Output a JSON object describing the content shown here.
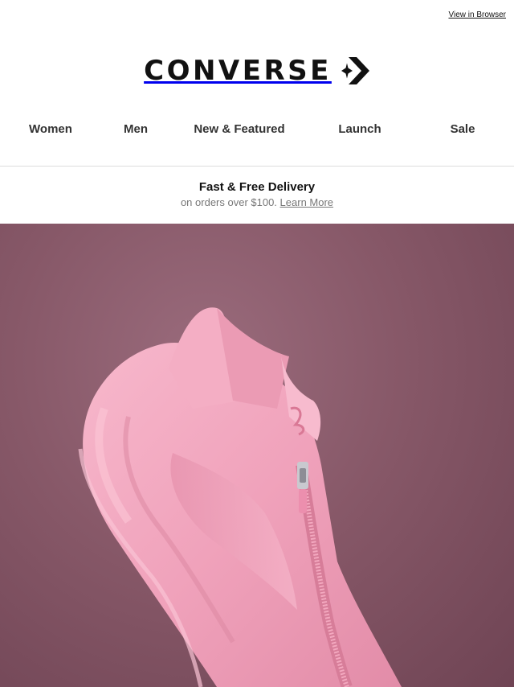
{
  "header": {
    "view_in_browser": "View in Browser",
    "brand": "CONVERSE"
  },
  "nav": {
    "items": [
      {
        "label": "Women"
      },
      {
        "label": "Men"
      },
      {
        "label": "New & Featured"
      },
      {
        "label": "Launch"
      },
      {
        "label": "Sale"
      }
    ]
  },
  "promo": {
    "title": "Fast & Free Delivery",
    "subtitle": "on orders over $100.",
    "link": "Learn More"
  },
  "hero": {
    "image": "pink-zip-sneaker",
    "background_color": "#875868",
    "product_color": "#f2a3bd"
  }
}
